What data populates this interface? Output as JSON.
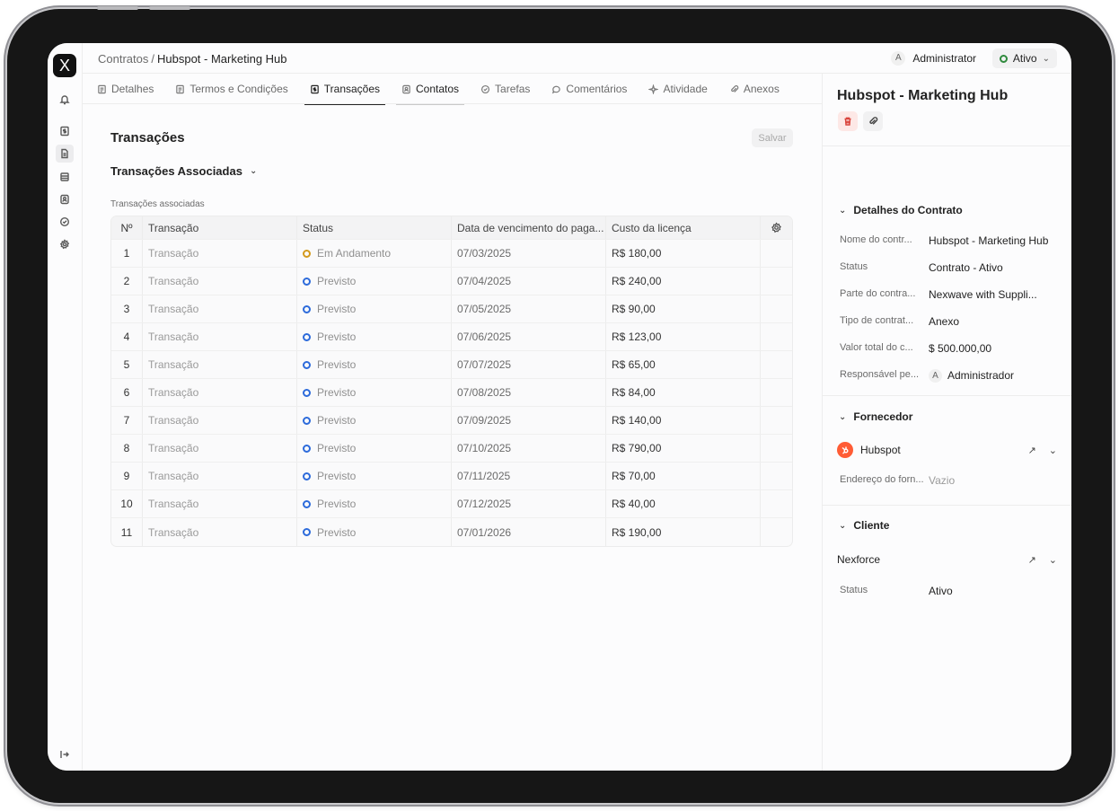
{
  "header": {
    "breadcrumb_parent": "Contratos",
    "breadcrumb_sep": "/",
    "breadcrumb_current": "Hubspot - Marketing Hub",
    "user_initial": "A",
    "user_name": "Administrator",
    "status_label": "Ativo"
  },
  "tabs": [
    {
      "label": "Detalhes",
      "icon": "document-icon"
    },
    {
      "label": "Termos e Condições",
      "icon": "document-icon"
    },
    {
      "label": "Transações",
      "icon": "dollar-doc-icon"
    },
    {
      "label": "Contatos",
      "icon": "contact-icon"
    },
    {
      "label": "Tarefas",
      "icon": "check-circle-icon"
    },
    {
      "label": "Comentários",
      "icon": "chat-icon"
    },
    {
      "label": "Atividade",
      "icon": "sparkle-icon"
    },
    {
      "label": "Anexos",
      "icon": "paperclip-icon"
    }
  ],
  "main": {
    "title": "Transações",
    "save_label": "Salvar",
    "subtitle": "Transações Associadas",
    "table_label": "Transações associadas",
    "columns": [
      "Nº",
      "Transação",
      "Status",
      "Data de vencimento do paga...",
      "Custo da licença"
    ],
    "rows": [
      {
        "no": "1",
        "tx": "Transação",
        "status": "Em Andamento",
        "status_kind": "progress",
        "date": "07/03/2025",
        "cost": "R$ 180,00"
      },
      {
        "no": "2",
        "tx": "Transação",
        "status": "Previsto",
        "status_kind": "planned",
        "date": "07/04/2025",
        "cost": "R$ 240,00"
      },
      {
        "no": "3",
        "tx": "Transação",
        "status": "Previsto",
        "status_kind": "planned",
        "date": "07/05/2025",
        "cost": "R$ 90,00"
      },
      {
        "no": "4",
        "tx": "Transação",
        "status": "Previsto",
        "status_kind": "planned",
        "date": "07/06/2025",
        "cost": "R$ 123,00"
      },
      {
        "no": "5",
        "tx": "Transação",
        "status": "Previsto",
        "status_kind": "planned",
        "date": "07/07/2025",
        "cost": "R$ 65,00"
      },
      {
        "no": "6",
        "tx": "Transação",
        "status": "Previsto",
        "status_kind": "planned",
        "date": "07/08/2025",
        "cost": "R$ 84,00"
      },
      {
        "no": "7",
        "tx": "Transação",
        "status": "Previsto",
        "status_kind": "planned",
        "date": "07/09/2025",
        "cost": "R$ 140,00"
      },
      {
        "no": "8",
        "tx": "Transação",
        "status": "Previsto",
        "status_kind": "planned",
        "date": "07/10/2025",
        "cost": "R$ 790,00"
      },
      {
        "no": "9",
        "tx": "Transação",
        "status": "Previsto",
        "status_kind": "planned",
        "date": "07/11/2025",
        "cost": "R$ 70,00"
      },
      {
        "no": "10",
        "tx": "Transação",
        "status": "Previsto",
        "status_kind": "planned",
        "date": "07/12/2025",
        "cost": "R$ 40,00"
      },
      {
        "no": "11",
        "tx": "Transação",
        "status": "Previsto",
        "status_kind": "planned",
        "date": "07/01/2026",
        "cost": "R$ 190,00"
      }
    ]
  },
  "panel": {
    "title": "Hubspot - Marketing Hub",
    "contract_section": "Detalhes do Contrato",
    "contract_fields": [
      {
        "key": "Nome do contr...",
        "value": "Hubspot - Marketing Hub"
      },
      {
        "key": "Status",
        "value": "Contrato - Ativo"
      },
      {
        "key": "Parte do contra...",
        "value": "Nexwave with Suppli..."
      },
      {
        "key": "Tipo de contrat...",
        "value": "Anexo"
      },
      {
        "key": "Valor total do c...",
        "value": "$ 500.000,00"
      },
      {
        "key": "Responsável pe...",
        "value": "Administrador",
        "avatar": "A"
      }
    ],
    "supplier_section": "Fornecedor",
    "supplier_name": "Hubspot",
    "supplier_address_key": "Endereço do forn...",
    "supplier_address_value": "Vazio",
    "client_section": "Cliente",
    "client_name": "Nexforce",
    "client_status_key": "Status",
    "client_status_value": "Ativo"
  },
  "colors": {
    "accent_status_active": "#2f8a3d",
    "status_planned": "#2d6bdb",
    "status_progress": "#d39a1d",
    "hubspot": "#ff5c35",
    "delete": "#d9433b"
  }
}
